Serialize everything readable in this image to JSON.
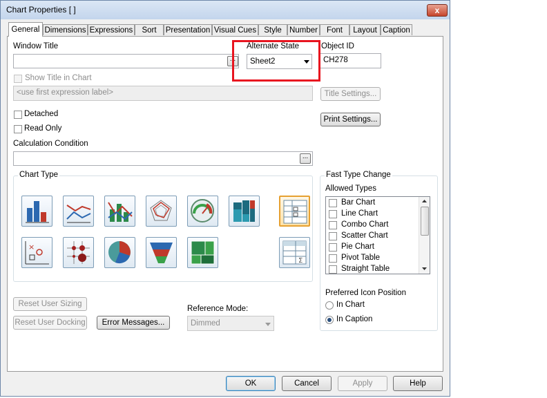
{
  "window": {
    "title": "Chart Properties [    ]",
    "close_glyph": "x"
  },
  "tabs": [
    "General",
    "Dimensions",
    "Expressions",
    "Sort",
    "Presentation",
    "Visual Cues",
    "Style",
    "Number",
    "Font",
    "Layout",
    "Caption"
  ],
  "general": {
    "window_title_label": "Window Title",
    "window_title_value": "",
    "ellipsis": "...",
    "alternate_state_label": "Alternate State",
    "alternate_state_value": "Sheet2",
    "object_id_label": "Object ID",
    "object_id_value": "CH278",
    "show_title_label": "Show Title in Chart",
    "title_placeholder": "<use first expression label>",
    "title_settings_label": "Title Settings...",
    "print_settings_label": "Print Settings...",
    "detached_label": "Detached",
    "read_only_label": "Read Only",
    "calc_condition_label": "Calculation Condition",
    "calc_condition_value": ""
  },
  "chart_type": {
    "group_label": "Chart Type",
    "icons": [
      "bar-chart",
      "line-chart",
      "combo-chart",
      "radar-chart",
      "gauge-chart",
      "mekko-chart",
      "pivot-table",
      "scatter-chart",
      "grid-chart",
      "pie-chart",
      "funnel-chart",
      "block-chart",
      "straight-table"
    ],
    "selected": "pivot-table"
  },
  "fast_type_change": {
    "group_label": "Fast Type Change",
    "allowed_types_label": "Allowed Types",
    "items": [
      "Bar Chart",
      "Line Chart",
      "Combo Chart",
      "Scatter Chart",
      "Pie Chart",
      "Pivot Table",
      "Straight Table"
    ],
    "preferred_icon_label": "Preferred Icon Position",
    "in_chart_label": "In Chart",
    "in_caption_label": "In Caption",
    "selected_position": "In Caption"
  },
  "bottom": {
    "reset_user_sizing": "Reset User Sizing",
    "reset_user_docking": "Reset User Docking",
    "error_messages": "Error Messages...",
    "reference_mode_label": "Reference Mode:",
    "reference_mode_value": "Dimmed"
  },
  "footer": {
    "ok": "OK",
    "cancel": "Cancel",
    "apply": "Apply",
    "help": "Help"
  },
  "colors": {
    "highlight": "#e8141f",
    "selected_icon_border": "#e6a030"
  }
}
